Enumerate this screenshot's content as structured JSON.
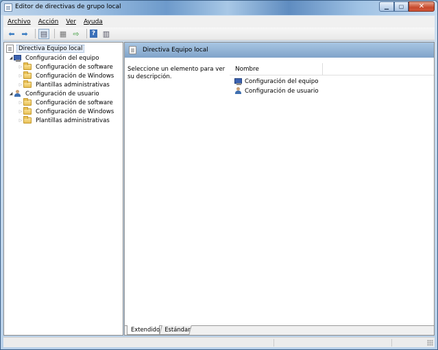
{
  "window": {
    "title": "Editor de directivas de grupo local"
  },
  "menu": [
    {
      "accel": "A",
      "rest": "rchivo"
    },
    {
      "accel": "A",
      "rest": "cción"
    },
    {
      "accel": "V",
      "rest": "er"
    },
    {
      "accel": "Ay",
      "rest": "uda"
    }
  ],
  "toolbar": {
    "icons": [
      "back-arrow-icon",
      "forward-arrow-icon",
      "show-hide-tree-icon",
      "properties-icon",
      "export-list-icon",
      "help-icon",
      "extended-view-icon"
    ]
  },
  "tree": {
    "root": "Directiva Equipo local",
    "computer": "Configuración del equipo",
    "computer_children": [
      "Configuración de software",
      "Configuración de Windows",
      "Plantillas administrativas"
    ],
    "user": "Configuración de usuario",
    "user_children": [
      "Configuración de software",
      "Configuración de Windows",
      "Plantillas administrativas"
    ]
  },
  "right_pane": {
    "title": "Directiva Equipo local",
    "description": "Seleccione un elemento para ver su descripción.",
    "column_name": "Nombre",
    "items": [
      "Configuración del equipo",
      "Configuración de usuario"
    ]
  },
  "tabs": [
    "Extendido",
    "Estándar"
  ],
  "colors": {
    "header_blue": "#7fa3c9",
    "title_accent": "#6d9acb",
    "close_red": "#c74a2d"
  }
}
